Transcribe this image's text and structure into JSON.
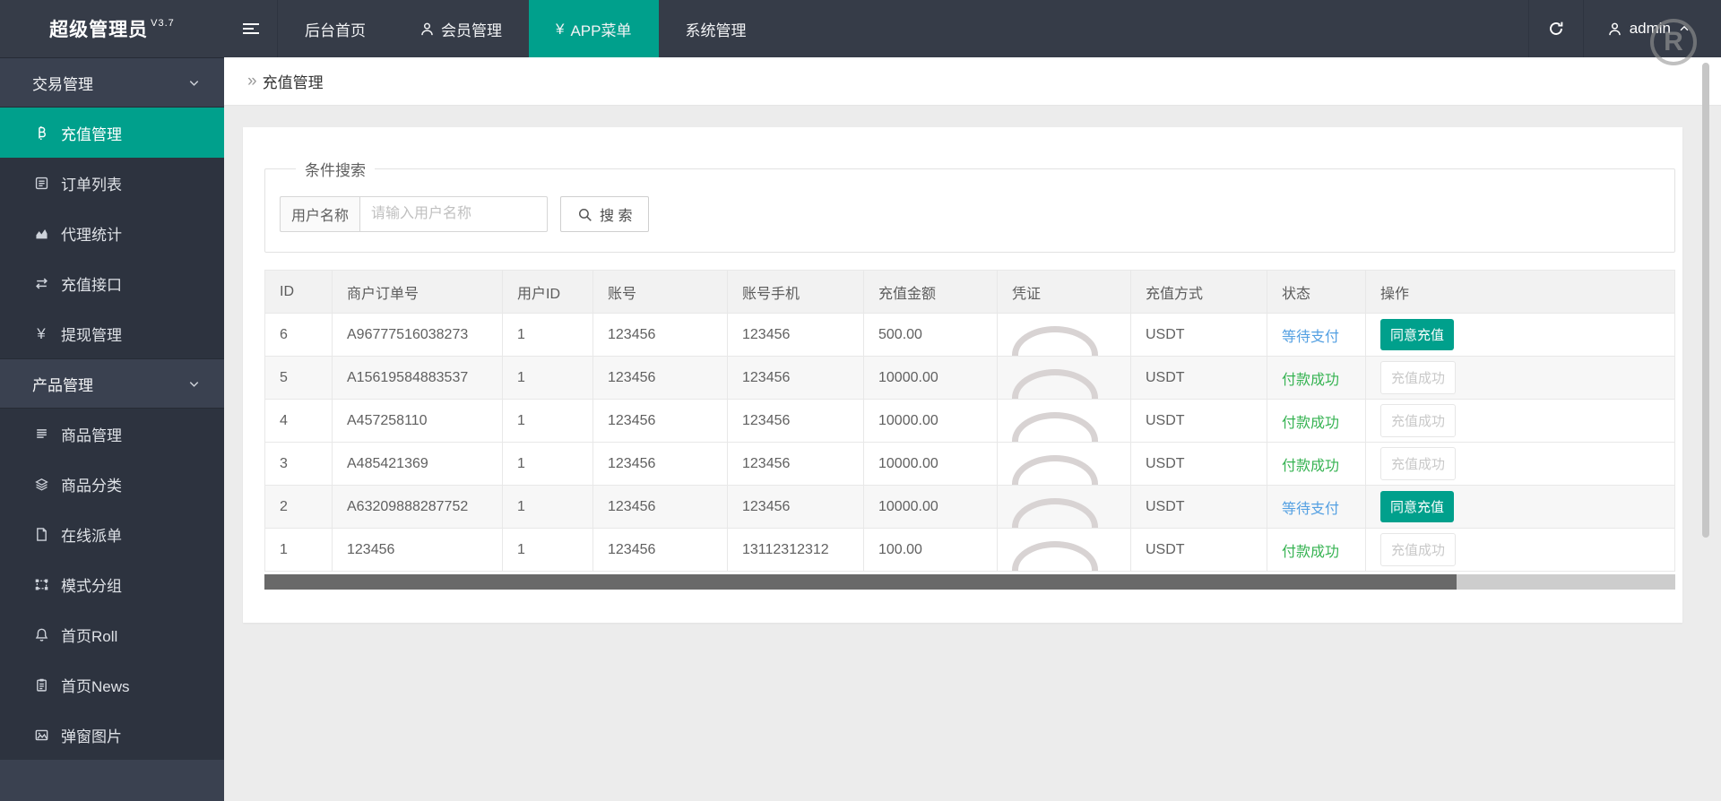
{
  "app": {
    "name": "超级管理员",
    "version": "V3.7"
  },
  "topnav": {
    "items": [
      {
        "label": "后台首页",
        "icon": null,
        "active": false
      },
      {
        "label": "会员管理",
        "icon": "person",
        "active": false
      },
      {
        "label": "APP菜单",
        "icon": "yen",
        "active": true
      },
      {
        "label": "系统管理",
        "icon": null,
        "active": false
      }
    ],
    "user": "admin"
  },
  "sidebar": {
    "groups": [
      {
        "label": "交易管理",
        "items": [
          {
            "label": "充值管理",
            "icon": "bitcoin",
            "active": true
          },
          {
            "label": "订单列表",
            "icon": "list-alt",
            "active": false
          },
          {
            "label": "代理统计",
            "icon": "area-chart",
            "active": false
          },
          {
            "label": "充值接口",
            "icon": "exchange",
            "active": false
          },
          {
            "label": "提现管理",
            "icon": "yen",
            "active": false
          }
        ]
      },
      {
        "label": "产品管理",
        "items": [
          {
            "label": "商品管理",
            "icon": "lines",
            "active": false
          },
          {
            "label": "商品分类",
            "icon": "layers",
            "active": false
          },
          {
            "label": "在线派单",
            "icon": "file",
            "active": false
          },
          {
            "label": "模式分组",
            "icon": "object-group",
            "active": false
          },
          {
            "label": "首页Roll",
            "icon": "bell",
            "active": false
          },
          {
            "label": "首页News",
            "icon": "clipboard",
            "active": false
          },
          {
            "label": "弹窗图片",
            "icon": "image",
            "active": false
          }
        ]
      }
    ]
  },
  "breadcrumb": {
    "title": "充值管理"
  },
  "search": {
    "legend": "条件搜索",
    "label": "用户名称",
    "placeholder": "请输入用户名称",
    "button": "搜 索"
  },
  "table": {
    "columns": [
      "ID",
      "商户订单号",
      "用户ID",
      "账号",
      "账号手机",
      "充值金额",
      "凭证",
      "充值方式",
      "状态",
      "操作"
    ],
    "rows": [
      {
        "id": "6",
        "order": "A96777516038273",
        "uid": "1",
        "account": "123456",
        "phone": "123456",
        "amount": "500.00",
        "method": "USDT",
        "status": "等待支付",
        "status_type": "pending",
        "action": "同意充值",
        "action_type": "primary",
        "shaded": false
      },
      {
        "id": "5",
        "order": "A15619584883537",
        "uid": "1",
        "account": "123456",
        "phone": "123456",
        "amount": "10000.00",
        "method": "USDT",
        "status": "付款成功",
        "status_type": "success",
        "action": "充值成功",
        "action_type": "disabled",
        "shaded": true
      },
      {
        "id": "4",
        "order": "A457258110",
        "uid": "1",
        "account": "123456",
        "phone": "123456",
        "amount": "10000.00",
        "method": "USDT",
        "status": "付款成功",
        "status_type": "success",
        "action": "充值成功",
        "action_type": "disabled",
        "shaded": false
      },
      {
        "id": "3",
        "order": "A485421369",
        "uid": "1",
        "account": "123456",
        "phone": "123456",
        "amount": "10000.00",
        "method": "USDT",
        "status": "付款成功",
        "status_type": "success",
        "action": "充值成功",
        "action_type": "disabled",
        "shaded": false
      },
      {
        "id": "2",
        "order": "A63209888287752",
        "uid": "1",
        "account": "123456",
        "phone": "123456",
        "amount": "10000.00",
        "method": "USDT",
        "status": "等待支付",
        "status_type": "pending",
        "action": "同意充值",
        "action_type": "primary",
        "shaded": true
      },
      {
        "id": "1",
        "order": "123456",
        "uid": "1",
        "account": "123456",
        "phone": "13112312312",
        "amount": "100.00",
        "method": "USDT",
        "status": "付款成功",
        "status_type": "success",
        "action": "充值成功",
        "action_type": "disabled",
        "shaded": false
      }
    ]
  },
  "colors": {
    "accent": "#00a08c",
    "status_pending_blue": "#54a0e2",
    "status_success_green": "#36b352",
    "topbar_bg": "#363c48",
    "sidebar_bg": "#2d333f",
    "sidebar_group_bg": "#3a4150"
  }
}
